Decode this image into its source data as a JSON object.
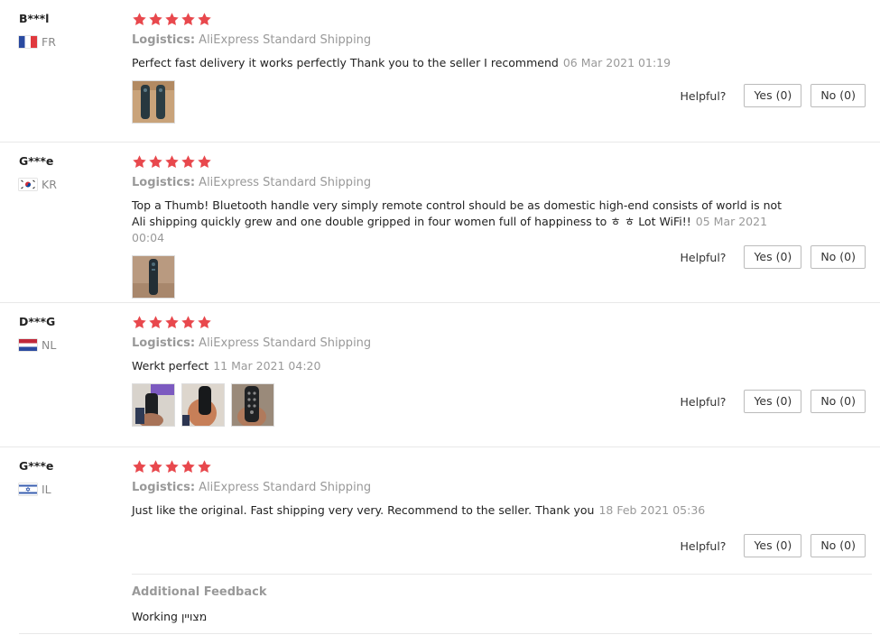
{
  "colors": {
    "star": "#e8484d",
    "muted_text": "#999999",
    "border": "#bbbbbb"
  },
  "helpful_label": "Helpful?",
  "reviews": [
    {
      "user": "B***l",
      "country": "FR",
      "rating": 5,
      "logistics_label": "Logistics:",
      "logistics_value": "AliExpress Standard Shipping",
      "text": "Perfect fast delivery it works perfectly Thank you to the seller I recommend",
      "date": "06 Mar 2021 01:19",
      "yes_label": "Yes (0)",
      "no_label": "No (0)",
      "photo_count": 1
    },
    {
      "user": "G***e",
      "country": "KR",
      "rating": 5,
      "logistics_label": "Logistics:",
      "logistics_value": "AliExpress Standard Shipping",
      "text": "Top a Thumb! Bluetooth handle very simply remote control should be as domestic high-end consists of world is not Ali shipping quickly grew and one double gripped in four women full of happiness to ㅎ ㅎ Lot WiFi!!",
      "date": "05 Mar 2021 00:04",
      "yes_label": "Yes (0)",
      "no_label": "No (0)",
      "photo_count": 1
    },
    {
      "user": "D***G",
      "country": "NL",
      "rating": 5,
      "logistics_label": "Logistics:",
      "logistics_value": "AliExpress Standard Shipping",
      "text": "Werkt perfect",
      "date": "11 Mar 2021 04:20",
      "yes_label": "Yes (0)",
      "no_label": "No (0)",
      "photo_count": 3
    },
    {
      "user": "G***e",
      "country": "IL",
      "rating": 5,
      "logistics_label": "Logistics:",
      "logistics_value": "AliExpress Standard Shipping",
      "text": "Just like the original. Fast shipping very very. Recommend to the seller. Thank you",
      "date": "18 Feb 2021 05:36",
      "yes_label": "Yes (0)",
      "no_label": "No (0)",
      "photo_count": 0
    }
  ],
  "additional_feedback": {
    "title": "Additional Feedback",
    "text": "Working מצויין"
  }
}
